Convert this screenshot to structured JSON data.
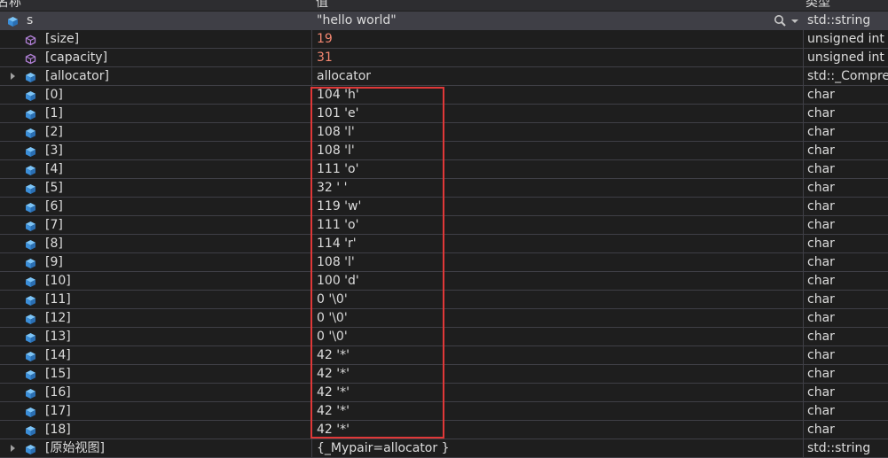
{
  "header": {
    "name": "名称",
    "value": "值",
    "type": "类型"
  },
  "colors": {
    "changed_value": "#f48771",
    "highlight_box": "#e03838",
    "field_icon": "#4fa3e8",
    "member_icon": "#b180d7"
  },
  "rows": [
    {
      "name": "s",
      "value": "\"hello world\"",
      "type": "std::string",
      "icon": "field-icon",
      "expander": "expanded"
    },
    {
      "name": "[size]",
      "value": "19",
      "type": "unsigned int",
      "icon": "member-icon",
      "changed": true
    },
    {
      "name": "[capacity]",
      "value": "31",
      "type": "unsigned int",
      "icon": "member-icon",
      "changed": true
    },
    {
      "name": "[allocator]",
      "value": "allocator",
      "type": "std::_Compres",
      "icon": "field-icon",
      "expander": "collapsed"
    },
    {
      "name": "[0]",
      "value": "104 'h'",
      "type": "char",
      "icon": "field-icon"
    },
    {
      "name": "[1]",
      "value": "101 'e'",
      "type": "char",
      "icon": "field-icon"
    },
    {
      "name": "[2]",
      "value": "108 'l'",
      "type": "char",
      "icon": "field-icon"
    },
    {
      "name": "[3]",
      "value": "108 'l'",
      "type": "char",
      "icon": "field-icon"
    },
    {
      "name": "[4]",
      "value": "111 'o'",
      "type": "char",
      "icon": "field-icon"
    },
    {
      "name": "[5]",
      "value": "32 ' '",
      "type": "char",
      "icon": "field-icon"
    },
    {
      "name": "[6]",
      "value": "119 'w'",
      "type": "char",
      "icon": "field-icon"
    },
    {
      "name": "[7]",
      "value": "111 'o'",
      "type": "char",
      "icon": "field-icon"
    },
    {
      "name": "[8]",
      "value": "114 'r'",
      "type": "char",
      "icon": "field-icon"
    },
    {
      "name": "[9]",
      "value": "108 'l'",
      "type": "char",
      "icon": "field-icon"
    },
    {
      "name": "[10]",
      "value": "100 'd'",
      "type": "char",
      "icon": "field-icon"
    },
    {
      "name": "[11]",
      "value": "0 '\\0'",
      "type": "char",
      "icon": "field-icon"
    },
    {
      "name": "[12]",
      "value": "0 '\\0'",
      "type": "char",
      "icon": "field-icon"
    },
    {
      "name": "[13]",
      "value": "0 '\\0'",
      "type": "char",
      "icon": "field-icon"
    },
    {
      "name": "[14]",
      "value": "42 '*'",
      "type": "char",
      "icon": "field-icon"
    },
    {
      "name": "[15]",
      "value": "42 '*'",
      "type": "char",
      "icon": "field-icon"
    },
    {
      "name": "[16]",
      "value": "42 '*'",
      "type": "char",
      "icon": "field-icon"
    },
    {
      "name": "[17]",
      "value": "42 '*'",
      "type": "char",
      "icon": "field-icon"
    },
    {
      "name": "[18]",
      "value": "42 '*'",
      "type": "char",
      "icon": "field-icon"
    },
    {
      "name": "[原始视图]",
      "value": "{_Mypair=allocator }",
      "type": "std::string",
      "icon": "field-icon",
      "expander": "collapsed"
    }
  ]
}
